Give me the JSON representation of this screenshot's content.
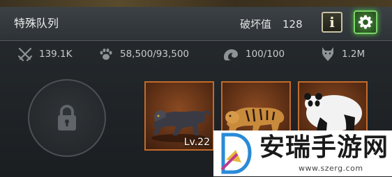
{
  "header": {
    "title": "特殊队列",
    "damage_label": "破坏值",
    "damage_value": "128",
    "info_label": "i"
  },
  "stats": [
    {
      "icon": "crossed-swords-icon",
      "value": "139.1K"
    },
    {
      "icon": "paw-icon",
      "value": "58,500/93,500"
    },
    {
      "icon": "shell-icon",
      "value": "100/100"
    },
    {
      "icon": "wolf-icon",
      "value": "1.2M"
    }
  ],
  "slots": [
    {
      "animal": "panther",
      "level": "Lv.22"
    },
    {
      "animal": "tiger",
      "level": ""
    },
    {
      "animal": "panda",
      "level": ""
    }
  ],
  "watermark": {
    "text": "安瑞手游网",
    "url": "www.szerg.com"
  },
  "colors": {
    "card_border": "#c26b2c",
    "settings_glow": "#53c43c"
  }
}
